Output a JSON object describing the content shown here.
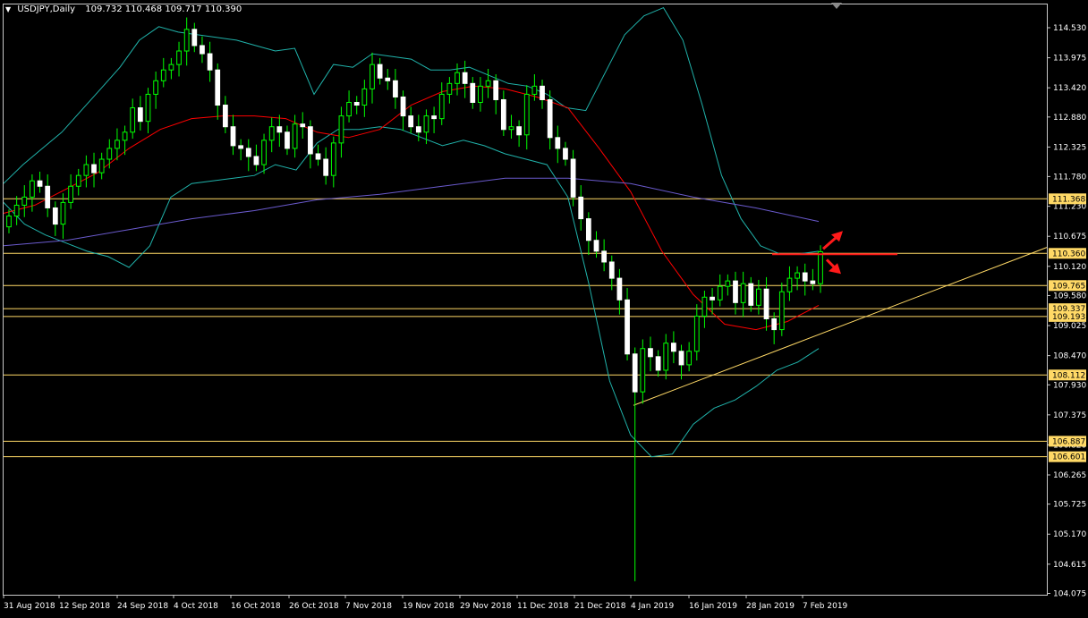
{
  "header": {
    "symbol": "USDJPY,Daily",
    "ohlc": "109.732 110.468 109.717 110.390"
  },
  "colors": {
    "background": "#000000",
    "bull_candle": "#00ff00",
    "bear_candle": "#ffffff",
    "bollinger": "#20b2aa",
    "ma_red": "#ff0000",
    "ma_blue": "#6a5acd",
    "levels": "#ffd966",
    "trendline": "#ffd966",
    "arrow": "#ff1a1a"
  },
  "chart_data": {
    "type": "candlestick",
    "symbol": "USDJPY",
    "timeframe": "Daily",
    "last_ohlc": {
      "open": 109.732,
      "high": 110.468,
      "low": 109.717,
      "close": 110.39
    },
    "y_ticks": [
      "114.530",
      "113.975",
      "113.420",
      "112.880",
      "112.325",
      "111.780",
      "111.230",
      "110.675",
      "110.120",
      "109.580",
      "109.025",
      "108.470",
      "107.930",
      "107.375",
      "106.820",
      "106.265",
      "105.725",
      "105.170",
      "104.615",
      "104.075"
    ],
    "y_range": [
      104.05,
      114.96
    ],
    "x_ticks": [
      "31 Aug 2018",
      "12 Sep 2018",
      "24 Sep 2018",
      "4 Oct 2018",
      "16 Oct 2018",
      "26 Oct 2018",
      "7 Nov 2018",
      "19 Nov 2018",
      "29 Nov 2018",
      "11 Dec 2018",
      "21 Dec 2018",
      "4 Jan 2019",
      "16 Jan 2019",
      "28 Jan 2019",
      "7 Feb 2019"
    ],
    "levels": [
      {
        "label": "111.368",
        "price": 111.368
      },
      {
        "label": "110.360",
        "price": 110.36
      },
      {
        "label": "109.765",
        "price": 109.765
      },
      {
        "label": "109.337",
        "price": 109.337
      },
      {
        "label": "109.193",
        "price": 109.193
      },
      {
        "label": "108.112",
        "price": 108.112
      },
      {
        "label": "106.887",
        "price": 106.887
      },
      {
        "label": "106.601",
        "price": 106.601
      }
    ],
    "trendline": {
      "start": [
        "4 Jan 2019",
        107.55
      ],
      "end": [
        "beyond 7 Feb 2019",
        110.47
      ]
    },
    "resistance_marker": {
      "price": 110.36,
      "arrows": [
        "up",
        "down"
      ]
    },
    "candles_sampled": [
      111.05,
      111.25,
      111.4,
      111.7,
      111.6,
      111.2,
      110.9,
      111.3,
      111.6,
      111.8,
      112.0,
      111.85,
      112.1,
      112.3,
      112.45,
      112.6,
      113.05,
      112.8,
      113.3,
      113.55,
      113.75,
      113.85,
      114.1,
      114.5,
      114.2,
      114.05,
      113.75,
      113.1,
      112.7,
      112.35,
      112.3,
      112.15,
      112.0,
      112.45,
      112.7,
      112.6,
      112.3,
      112.75,
      112.7,
      112.2,
      112.1,
      111.8,
      112.4,
      112.9,
      113.15,
      113.1,
      113.4,
      113.85,
      113.6,
      113.55,
      113.25,
      112.9,
      112.7,
      112.6,
      112.9,
      112.85,
      113.3,
      113.5,
      113.7,
      113.5,
      113.15,
      113.45,
      113.55,
      113.2,
      112.65,
      112.7,
      112.55,
      113.3,
      113.45,
      113.2,
      112.5,
      112.3,
      112.1,
      111.4,
      111.0,
      110.6,
      110.4,
      110.2,
      109.9,
      109.5,
      108.5,
      107.8,
      108.6,
      108.45,
      108.2,
      108.7,
      108.55,
      108.3,
      108.55,
      109.2,
      109.55,
      109.5,
      109.75,
      109.85,
      109.45,
      109.8,
      109.4,
      109.7,
      109.15,
      108.95,
      109.65,
      109.9,
      110.0,
      109.85,
      109.8,
      110.39
    ],
    "series": [
      {
        "name": "Bollinger Upper",
        "values": [
          111.65,
          112.0,
          112.3,
          112.6,
          113.0,
          113.4,
          113.8,
          114.3,
          114.55,
          114.45,
          114.4,
          114.35,
          114.3,
          114.2,
          114.1,
          114.15,
          113.3,
          113.85,
          113.8,
          114.05,
          114.0,
          113.95,
          113.75,
          113.75,
          113.8,
          113.65,
          113.5,
          113.45,
          113.3,
          113.05,
          113.0,
          113.7,
          114.4,
          114.75,
          114.9,
          114.3,
          113.1,
          111.8,
          111.0,
          110.5,
          110.35,
          110.35,
          110.4
        ]
      },
      {
        "name": "Bollinger Lower",
        "values": [
          111.3,
          110.9,
          110.7,
          110.55,
          110.4,
          110.3,
          110.1,
          110.5,
          111.4,
          111.65,
          111.7,
          111.75,
          111.8,
          112.0,
          111.9,
          112.4,
          112.65,
          112.65,
          112.7,
          112.65,
          112.5,
          112.35,
          112.45,
          112.35,
          112.2,
          112.1,
          112.0,
          111.4,
          109.8,
          108.0,
          107.0,
          106.6,
          106.65,
          107.2,
          107.5,
          107.65,
          107.9,
          108.2,
          108.35,
          108.6
        ]
      },
      {
        "name": "MA Red",
        "values": [
          111.1,
          111.25,
          111.55,
          111.85,
          112.3,
          112.65,
          112.85,
          112.9,
          112.9,
          112.85,
          112.6,
          112.5,
          112.65,
          113.1,
          113.35,
          113.45,
          113.4,
          113.25,
          113.05,
          112.3,
          111.5,
          110.4,
          109.6,
          109.05,
          108.95,
          109.1,
          109.4
        ]
      },
      {
        "name": "MA Blue",
        "values": [
          110.5,
          110.6,
          110.8,
          111.0,
          111.15,
          111.35,
          111.45,
          111.6,
          111.75,
          111.75,
          111.65,
          111.4,
          111.2,
          110.95
        ]
      }
    ]
  }
}
